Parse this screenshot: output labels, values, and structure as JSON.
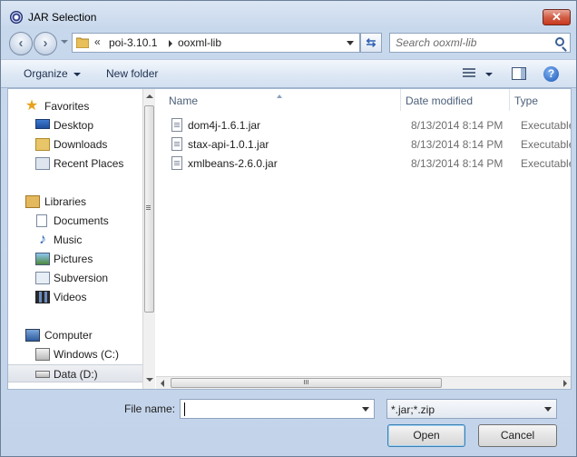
{
  "window": {
    "title": "JAR Selection",
    "close_label": "✕"
  },
  "address": {
    "overflow": "«",
    "crumbs": [
      "poi-3.10.1",
      "ooxml-lib"
    ]
  },
  "search": {
    "placeholder": "Search ooxml-lib"
  },
  "toolbar": {
    "organize": "Organize",
    "new_folder": "New folder",
    "help": "?"
  },
  "nav": {
    "items": [
      {
        "label": "Favorites",
        "icon": "star-icon"
      },
      {
        "label": "Desktop",
        "icon": "desktop-icon"
      },
      {
        "label": "Downloads",
        "icon": "downloads-icon"
      },
      {
        "label": "Recent Places",
        "icon": "recent-places-icon"
      },
      {
        "label": "Libraries",
        "icon": "libraries-icon"
      },
      {
        "label": "Documents",
        "icon": "documents-icon"
      },
      {
        "label": "Music",
        "icon": "music-icon"
      },
      {
        "label": "Pictures",
        "icon": "pictures-icon"
      },
      {
        "label": "Subversion",
        "icon": "subversion-icon"
      },
      {
        "label": "Videos",
        "icon": "videos-icon"
      },
      {
        "label": "Computer",
        "icon": "computer-icon"
      },
      {
        "label": "Windows (C:)",
        "icon": "windows-drive-icon"
      },
      {
        "label": "Data (D:)",
        "icon": "drive-icon"
      }
    ],
    "selected": "Data (D:)"
  },
  "files": {
    "columns": [
      "Name",
      "Date modified",
      "Type"
    ],
    "rows": [
      {
        "name": "dom4j-1.6.1.jar",
        "date": "8/13/2014 8:14 PM",
        "type": "Executable Ja"
      },
      {
        "name": "stax-api-1.0.1.jar",
        "date": "8/13/2014 8:14 PM",
        "type": "Executable Ja"
      },
      {
        "name": "xmlbeans-2.6.0.jar",
        "date": "8/13/2014 8:14 PM",
        "type": "Executable Ja"
      }
    ]
  },
  "footer": {
    "file_name_label": "File name:",
    "file_name_value": "",
    "filter": "*.jar;*.zip",
    "open": "Open",
    "cancel": "Cancel"
  },
  "colors": {
    "titlebar": "#c8d8ec",
    "close": "#c8381e",
    "link": "#1e3050"
  }
}
